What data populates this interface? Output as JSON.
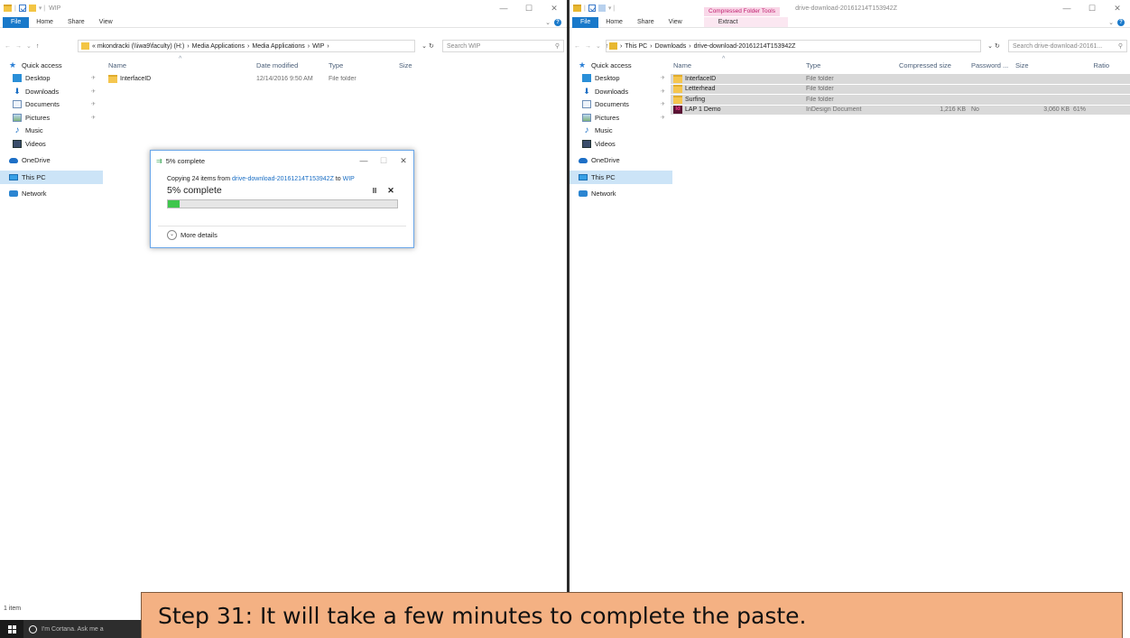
{
  "left_window": {
    "title": "WIP",
    "ribbon_tabs": [
      "File",
      "Home",
      "Share",
      "View"
    ],
    "breadcrumb": [
      "« mkondracki (\\\\iwa9\\faculty) (H:)",
      "Media Applications",
      "Media Applications",
      "WIP"
    ],
    "search_placeholder": "Search WIP",
    "columns": [
      "Name",
      "Date modified",
      "Type",
      "Size"
    ],
    "files": [
      {
        "name": "InterfaceID",
        "date": "12/14/2016 9:50 AM",
        "type": "File folder",
        "size": ""
      }
    ],
    "status": "1 item"
  },
  "right_window": {
    "title": "drive-download-20161214T153942Z",
    "context_tab": "Compressed Folder Tools",
    "ribbon_tabs": [
      "File",
      "Home",
      "Share",
      "View",
      "Extract"
    ],
    "breadcrumb": [
      "This PC",
      "Downloads",
      "drive-download-20161214T153942Z"
    ],
    "search_placeholder": "Search drive-download-20161...",
    "columns": [
      "Name",
      "Type",
      "Compressed size",
      "Password ...",
      "Size",
      "Ratio"
    ],
    "files": [
      {
        "name": "InterfaceID",
        "type": "File folder",
        "compressed": "",
        "password": "",
        "size": "",
        "ratio": "",
        "icon": "folder-icon"
      },
      {
        "name": "Letterhead",
        "type": "File folder",
        "compressed": "",
        "password": "",
        "size": "",
        "ratio": "",
        "icon": "folder-icon"
      },
      {
        "name": "Surfing",
        "type": "File folder",
        "compressed": "",
        "password": "",
        "size": "",
        "ratio": "",
        "icon": "folder-icon"
      },
      {
        "name": "LAP 1 Demo",
        "type": "InDesign Document",
        "compressed": "1,216 KB",
        "password": "No",
        "size": "3,060 KB",
        "ratio": "61%",
        "icon": "indesign-icon"
      }
    ]
  },
  "nav_pane": {
    "quick_access": "Quick access",
    "quick_items": [
      "Desktop",
      "Downloads",
      "Documents",
      "Pictures",
      "Music",
      "Videos"
    ],
    "onedrive": "OneDrive",
    "this_pc": "This PC",
    "network": "Network"
  },
  "copy_dialog": {
    "title": "5% complete",
    "copy_prefix": "Copying 24 items from",
    "source": "drive-download-20161214T153942Z",
    "to_word": "to",
    "dest": "WIP",
    "percent_text": "5% complete",
    "progress": 0.05,
    "more_details": "More details"
  },
  "taskbar": {
    "cortana_text": "I'm Cortana. Ask me a"
  },
  "caption": {
    "text": "Step 31: It will take a few minutes to complete the paste."
  },
  "colors": {
    "accent": "#1979ca",
    "progress_green": "#3ec64c",
    "caption_bg": "#f4b183",
    "selection": "#cce4f7"
  }
}
